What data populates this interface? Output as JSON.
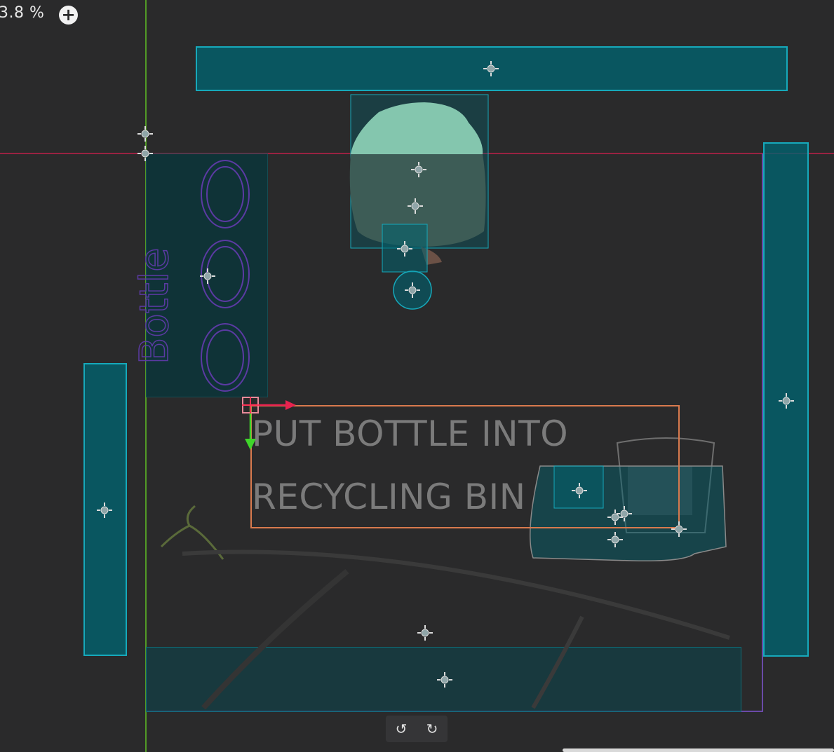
{
  "zoom": {
    "label": "3.8 %",
    "add_icon": "plus-circle-icon"
  },
  "text_node": {
    "line1": "PUT BOTTLE INTO",
    "line2": "RECYCLING BIN"
  },
  "bottle_panel": {
    "handwriting": "Bottle"
  },
  "toolbar": {
    "undo_icon": "rotate-ccw-icon",
    "redo_icon": "rotate-cw-icon",
    "undo_glyph": "↺",
    "redo_glyph": "↻"
  },
  "colors": {
    "background": "#2a2a2b",
    "collider_fill": "#006370",
    "collider_border": "#16a9bb",
    "guide_vertical": "#5fbf24",
    "guide_horizontal": "#c0204a",
    "viewport_border": "#6a4aa8",
    "text_frame": "#d97a4e",
    "gizmo_x": "#e8234f",
    "gizmo_y": "#3fd62a"
  }
}
